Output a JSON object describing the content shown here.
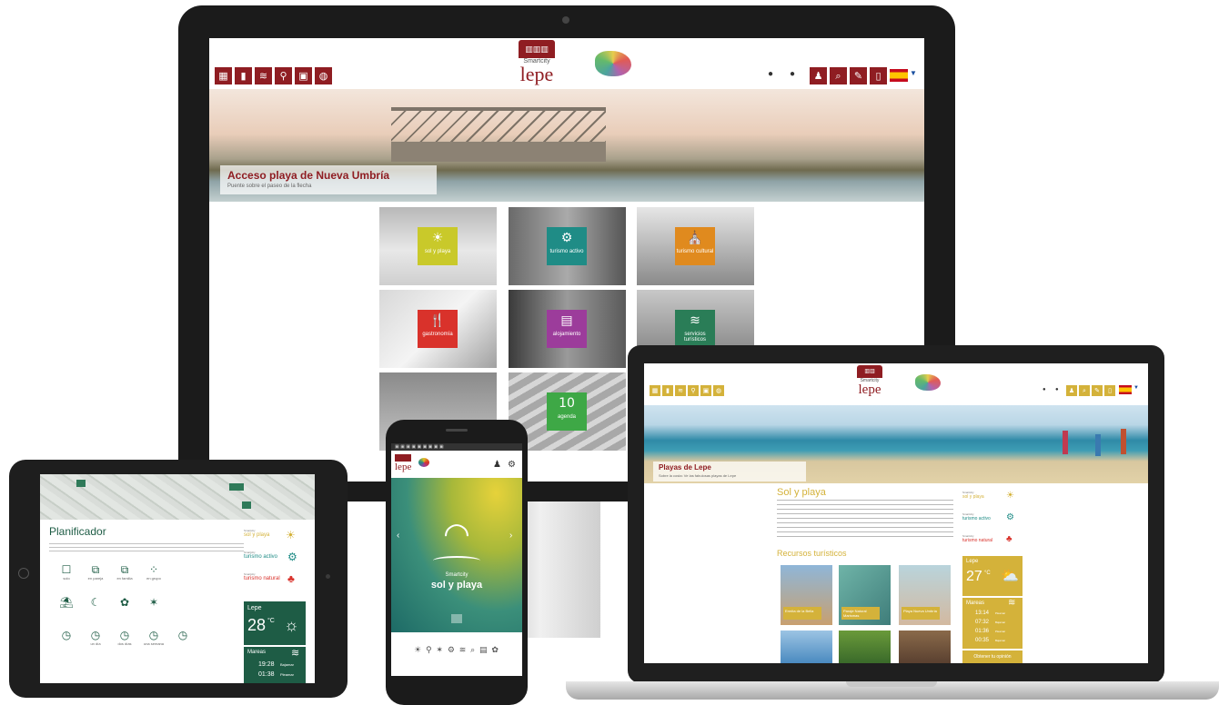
{
  "desktop": {
    "logo": {
      "small": "Smartcity",
      "name": "lepe"
    },
    "toolbar_left": [
      "▦",
      "▮",
      "≋",
      "⚲",
      "▣",
      "◍"
    ],
    "toolbar_right": [
      "♟",
      "⌕",
      "✎",
      "▯"
    ],
    "hero": {
      "title": "Acceso playa de Nueva Umbría",
      "subtitle": "Puente sobre el paseo de la flecha"
    },
    "tiles": [
      {
        "label": "sol y playa",
        "icon": "☀",
        "color": "#c9c92a"
      },
      {
        "label": "turismo activo",
        "icon": "⚙",
        "color": "#1f8c86"
      },
      {
        "label": "turismo cultural",
        "icon": "⛪",
        "color": "#e08a1e"
      },
      {
        "label": "gastronomía",
        "icon": "🍴",
        "color": "#d9322b"
      },
      {
        "label": "alojamiento",
        "icon": "▤",
        "color": "#9c3c9b"
      },
      {
        "label": "servicios turísticos",
        "icon": "≋",
        "color": "#2a7d57"
      },
      {
        "label": "",
        "icon": "",
        "color": ""
      },
      {
        "label": "agenda",
        "icon": "10",
        "color": "#3ea846"
      }
    ]
  },
  "laptop": {
    "logo": {
      "small": "Smartcity",
      "name": "lepe"
    },
    "toolbar_left": [
      "▦",
      "▮",
      "≋",
      "⚲",
      "▣",
      "◍"
    ],
    "toolbar_right": [
      "♟",
      "⌕",
      "✎",
      "▯"
    ],
    "hero": {
      "title": "Playas de Lepe",
      "subtitle": "Sobre la costa: Ve las fabulosas playas de Lepe"
    },
    "section_title": "Sol y playa",
    "resources_title": "Recursos turísticos",
    "brands": [
      {
        "small": "Smartcity",
        "name": "sol y playa",
        "color": "#d4b23a"
      },
      {
        "small": "Smartcity",
        "name": "turismo activo",
        "color": "#1f8c86"
      },
      {
        "small": "Smartcity",
        "name": "turismo natural",
        "color": "#d9322b"
      }
    ],
    "weather": {
      "city": "Lepe",
      "temp": "27",
      "unit": "°C",
      "icon": "⛅"
    },
    "tides": {
      "title": "Mareas",
      "rows": [
        {
          "label": "Pleamar",
          "time": "13:14"
        },
        {
          "label": "Bajamar",
          "time": "07:32"
        },
        {
          "label": "Pleamar",
          "time": "01:36"
        },
        {
          "label": "Bajamar",
          "time": "00:35"
        }
      ]
    },
    "more_button": "Obtener tu opinión",
    "resources": [
      {
        "caption": "Ermita de la Bella"
      },
      {
        "caption": "Paraje Natural Marismas"
      },
      {
        "caption": "Playa Nueva Umbría"
      }
    ]
  },
  "tablet": {
    "title": "Planificador",
    "description": "Planifica tu visita a Lepe. Cuéntanos cómo viajas, cuántos tienes tiempo y qué te interesa y tenemos una propuesta a tu medida",
    "options": [
      {
        "icon": "☐",
        "label": "solo"
      },
      {
        "icon": "⧉",
        "label": "en pareja"
      },
      {
        "icon": "⧉",
        "label": "en familia"
      },
      {
        "icon": "⁘",
        "label": "en grupo"
      },
      {
        "icon": "⛱",
        "label": ""
      },
      {
        "icon": "☾",
        "label": ""
      },
      {
        "icon": "✿",
        "label": ""
      },
      {
        "icon": "✶",
        "label": ""
      },
      {
        "icon": "◷",
        "label": ""
      },
      {
        "icon": "◷",
        "label": "un día"
      },
      {
        "icon": "◷",
        "label": "dos días"
      },
      {
        "icon": "◷",
        "label": "una semana"
      },
      {
        "icon": "◷",
        "label": ""
      }
    ],
    "brands": [
      {
        "small": "Smartcity",
        "name": "sol y playa",
        "color": "#d4b23a"
      },
      {
        "small": "Smartcity",
        "name": "turismo activo",
        "color": "#1f8c86"
      },
      {
        "small": "Smartcity",
        "name": "turismo natural",
        "color": "#d9322b"
      }
    ],
    "weather": {
      "city": "Lepe",
      "temp": "28",
      "unit": "°C",
      "icon": "☼"
    },
    "tides": {
      "title": "Mareas",
      "rows": [
        {
          "label": "Bajamar",
          "time": "19:28"
        },
        {
          "label": "Pleamar",
          "time": "01:38"
        }
      ]
    }
  },
  "phone": {
    "logo": "lepe",
    "header_icons": [
      "♟",
      "⚙"
    ],
    "rays": "◠",
    "small": "Smartcity",
    "name": "sol y playa",
    "nav_icons": "☀ ⚲ ✶ ⚙ ≋ ⌕ ▤ ✿"
  }
}
